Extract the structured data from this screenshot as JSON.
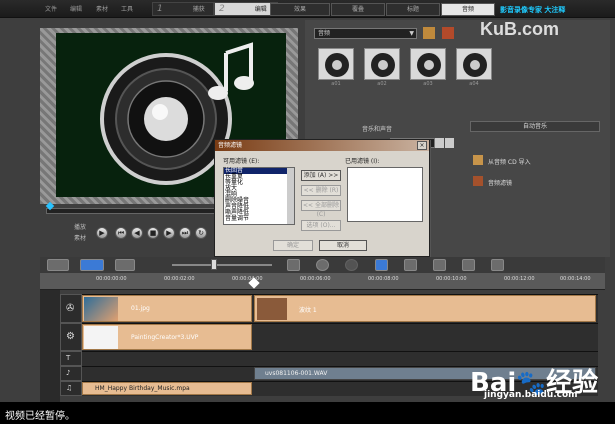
{
  "menu": {
    "file": "文件",
    "edit": "编辑",
    "clip": "素材",
    "tools": "工具"
  },
  "steps": [
    {
      "num": "1",
      "label": "捕获"
    },
    {
      "num": "2",
      "label": "编辑"
    }
  ],
  "tabs": [
    "效果",
    "覆叠",
    "标题",
    "音频"
  ],
  "brand_text": "影音录像专家 大注释",
  "watermark_top": "KuB.com",
  "preview": {
    "play_label": "播放",
    "mode_label": "素材"
  },
  "library": {
    "category": "音频",
    "thumbs": [
      "a01",
      "a02",
      "a03",
      "a04"
    ],
    "music_section": "音乐和声音",
    "auto_music": "自动音乐",
    "cd_import": "从音频 CD 导入",
    "audio_filter": "音频滤镜"
  },
  "dialog": {
    "title": "音频滤镜",
    "available_label": "可用滤镜 (E):",
    "applied_label": "已用滤镜 (I):",
    "available": [
      "长回音",
      "长重复",
      "等量化",
      "放大",
      "混响",
      "删除噪音",
      "声音降低",
      "嘶声降低",
      "音量调节",
      "回音"
    ],
    "add": "添加 (A) >>",
    "remove": "<< 删除 (R)",
    "remove_all": "<< 全部删除 (C)",
    "options": "选项 (O)...",
    "ok": "确定",
    "cancel": "取消"
  },
  "ruler": [
    "00:00:00:00",
    "00:00:02:00",
    "00:00:04:00",
    "00:00:06:00",
    "00:00:08:00",
    "00:00:10:00",
    "00:00:12:00",
    "00:00:14:00"
  ],
  "tracks": {
    "video_clip": "01.jpg",
    "video_clip2": "波纹 1",
    "overlay_clip": "PaintingCreator*3.UVP",
    "voice_clip": "uvs081106-001.WAV",
    "music_clip": "HM_Happy Birthday_Music.mpa"
  },
  "watermark_bottom": "Bai",
  "watermark_bottom2": "经验",
  "watermark_url": "jingyan.baidu.com",
  "status": "视频已经暂停。"
}
